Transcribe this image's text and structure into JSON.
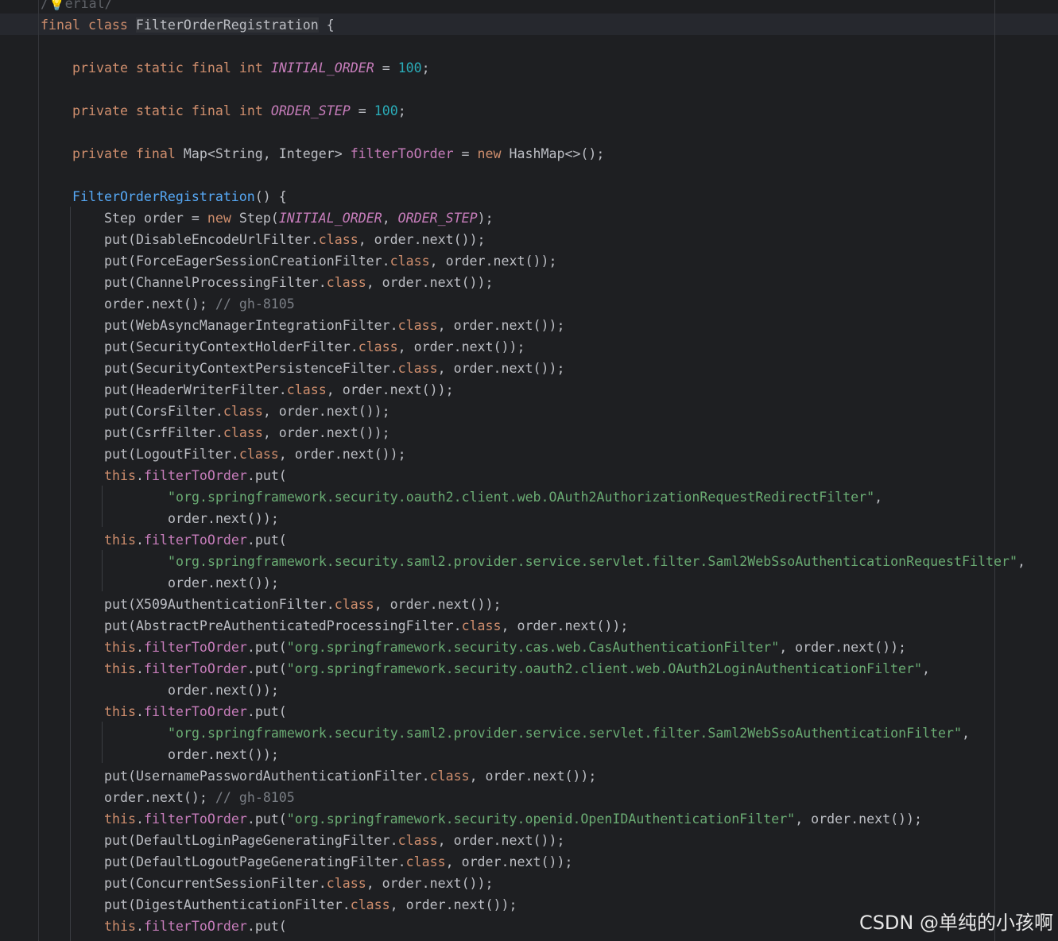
{
  "editor": {
    "lines": [
      {
        "indent": 0,
        "tokens": [
          {
            "t": "/",
            "c": "dim"
          },
          {
            "t": "💡",
            "c": "bulb"
          },
          {
            "t": "erial/",
            "c": "dim"
          }
        ]
      },
      {
        "indent": 0,
        "tokens": [
          {
            "t": "final",
            "c": "kw"
          },
          {
            "t": " "
          },
          {
            "t": "class",
            "c": "kw"
          },
          {
            "t": " "
          },
          {
            "t": "FilterOrderRegistration",
            "c": "cls"
          },
          {
            "t": " {"
          }
        ]
      },
      {
        "indent": 0,
        "tokens": []
      },
      {
        "indent": 1,
        "tokens": [
          {
            "t": "private",
            "c": "kw"
          },
          {
            "t": " "
          },
          {
            "t": "static",
            "c": "kw"
          },
          {
            "t": " "
          },
          {
            "t": "final",
            "c": "kw"
          },
          {
            "t": " "
          },
          {
            "t": "int",
            "c": "kw"
          },
          {
            "t": " "
          },
          {
            "t": "INITIAL_ORDER",
            "c": "const"
          },
          {
            "t": " = "
          },
          {
            "t": "100",
            "c": "num"
          },
          {
            "t": ";"
          }
        ]
      },
      {
        "indent": 0,
        "tokens": []
      },
      {
        "indent": 1,
        "tokens": [
          {
            "t": "private",
            "c": "kw"
          },
          {
            "t": " "
          },
          {
            "t": "static",
            "c": "kw"
          },
          {
            "t": " "
          },
          {
            "t": "final",
            "c": "kw"
          },
          {
            "t": " "
          },
          {
            "t": "int",
            "c": "kw"
          },
          {
            "t": " "
          },
          {
            "t": "ORDER_STEP",
            "c": "const"
          },
          {
            "t": " = "
          },
          {
            "t": "100",
            "c": "num"
          },
          {
            "t": ";"
          }
        ]
      },
      {
        "indent": 0,
        "tokens": []
      },
      {
        "indent": 1,
        "tokens": [
          {
            "t": "private",
            "c": "kw"
          },
          {
            "t": " "
          },
          {
            "t": "final",
            "c": "kw"
          },
          {
            "t": " Map<String, Integer> "
          },
          {
            "t": "filterToOrder",
            "c": "field"
          },
          {
            "t": " = "
          },
          {
            "t": "new",
            "c": "kw"
          },
          {
            "t": " HashMap<>();"
          }
        ]
      },
      {
        "indent": 0,
        "tokens": []
      },
      {
        "indent": 1,
        "tokens": [
          {
            "t": "FilterOrderRegistration",
            "c": "fn"
          },
          {
            "t": "() {"
          }
        ]
      },
      {
        "indent": 2,
        "tokens": [
          {
            "t": "Step order = "
          },
          {
            "t": "new",
            "c": "kw"
          },
          {
            "t": " Step("
          },
          {
            "t": "INITIAL_ORDER",
            "c": "const"
          },
          {
            "t": ", "
          },
          {
            "t": "ORDER_STEP",
            "c": "const"
          },
          {
            "t": ");"
          }
        ]
      },
      {
        "indent": 2,
        "tokens": [
          {
            "t": "put(DisableEncodeUrlFilter."
          },
          {
            "t": "class",
            "c": "kw"
          },
          {
            "t": ", order.next());"
          }
        ]
      },
      {
        "indent": 2,
        "tokens": [
          {
            "t": "put(ForceEagerSessionCreationFilter."
          },
          {
            "t": "class",
            "c": "kw"
          },
          {
            "t": ", order.next());"
          }
        ]
      },
      {
        "indent": 2,
        "tokens": [
          {
            "t": "put(ChannelProcessingFilter."
          },
          {
            "t": "class",
            "c": "kw"
          },
          {
            "t": ", order.next());"
          }
        ]
      },
      {
        "indent": 2,
        "tokens": [
          {
            "t": "order.next(); "
          },
          {
            "t": "// gh-8105",
            "c": "cmt"
          }
        ]
      },
      {
        "indent": 2,
        "tokens": [
          {
            "t": "put(WebAsyncManagerIntegrationFilter."
          },
          {
            "t": "class",
            "c": "kw"
          },
          {
            "t": ", order.next());"
          }
        ]
      },
      {
        "indent": 2,
        "tokens": [
          {
            "t": "put(SecurityContextHolderFilter."
          },
          {
            "t": "class",
            "c": "kw"
          },
          {
            "t": ", order.next());"
          }
        ]
      },
      {
        "indent": 2,
        "tokens": [
          {
            "t": "put(SecurityContextPersistenceFilter."
          },
          {
            "t": "class",
            "c": "kw"
          },
          {
            "t": ", order.next());"
          }
        ]
      },
      {
        "indent": 2,
        "tokens": [
          {
            "t": "put(HeaderWriterFilter."
          },
          {
            "t": "class",
            "c": "kw"
          },
          {
            "t": ", order.next());"
          }
        ]
      },
      {
        "indent": 2,
        "tokens": [
          {
            "t": "put(CorsFilter."
          },
          {
            "t": "class",
            "c": "kw"
          },
          {
            "t": ", order.next());"
          }
        ]
      },
      {
        "indent": 2,
        "tokens": [
          {
            "t": "put(CsrfFilter."
          },
          {
            "t": "class",
            "c": "kw"
          },
          {
            "t": ", order.next());"
          }
        ]
      },
      {
        "indent": 2,
        "tokens": [
          {
            "t": "put(LogoutFilter."
          },
          {
            "t": "class",
            "c": "kw"
          },
          {
            "t": ", order.next());"
          }
        ]
      },
      {
        "indent": 2,
        "tokens": [
          {
            "t": "this",
            "c": "kw"
          },
          {
            "t": "."
          },
          {
            "t": "filterToOrder",
            "c": "field"
          },
          {
            "t": ".put("
          }
        ]
      },
      {
        "indent": 4,
        "tokens": [
          {
            "t": "\"org.springframework.security.oauth2.client.web.OAuth2AuthorizationRequestRedirectFilter\"",
            "c": "str"
          },
          {
            "t": ","
          }
        ]
      },
      {
        "indent": 4,
        "tokens": [
          {
            "t": "order.next());"
          }
        ]
      },
      {
        "indent": 2,
        "tokens": [
          {
            "t": "this",
            "c": "kw"
          },
          {
            "t": "."
          },
          {
            "t": "filterToOrder",
            "c": "field"
          },
          {
            "t": ".put("
          }
        ]
      },
      {
        "indent": 4,
        "tokens": [
          {
            "t": "\"org.springframework.security.saml2.provider.service.servlet.filter.Saml2WebSsoAuthenticationRequestFilter\"",
            "c": "str"
          },
          {
            "t": ","
          }
        ]
      },
      {
        "indent": 4,
        "tokens": [
          {
            "t": "order.next());"
          }
        ]
      },
      {
        "indent": 2,
        "tokens": [
          {
            "t": "put(X509AuthenticationFilter."
          },
          {
            "t": "class",
            "c": "kw"
          },
          {
            "t": ", order.next());"
          }
        ]
      },
      {
        "indent": 2,
        "tokens": [
          {
            "t": "put(AbstractPreAuthenticatedProcessingFilter."
          },
          {
            "t": "class",
            "c": "kw"
          },
          {
            "t": ", order.next());"
          }
        ]
      },
      {
        "indent": 2,
        "tokens": [
          {
            "t": "this",
            "c": "kw"
          },
          {
            "t": "."
          },
          {
            "t": "filterToOrder",
            "c": "field"
          },
          {
            "t": ".put("
          },
          {
            "t": "\"org.springframework.security.cas.web.CasAuthenticationFilter\"",
            "c": "str"
          },
          {
            "t": ", order.next());"
          }
        ]
      },
      {
        "indent": 2,
        "tokens": [
          {
            "t": "this",
            "c": "kw"
          },
          {
            "t": "."
          },
          {
            "t": "filterToOrder",
            "c": "field"
          },
          {
            "t": ".put("
          },
          {
            "t": "\"org.springframework.security.oauth2.client.web.OAuth2LoginAuthenticationFilter\"",
            "c": "str"
          },
          {
            "t": ","
          }
        ]
      },
      {
        "indent": 4,
        "tokens": [
          {
            "t": "order.next());"
          }
        ]
      },
      {
        "indent": 2,
        "tokens": [
          {
            "t": "this",
            "c": "kw"
          },
          {
            "t": "."
          },
          {
            "t": "filterToOrder",
            "c": "field"
          },
          {
            "t": ".put("
          }
        ]
      },
      {
        "indent": 4,
        "tokens": [
          {
            "t": "\"org.springframework.security.saml2.provider.service.servlet.filter.Saml2WebSsoAuthenticationFilter\"",
            "c": "str"
          },
          {
            "t": ","
          }
        ]
      },
      {
        "indent": 4,
        "tokens": [
          {
            "t": "order.next());"
          }
        ]
      },
      {
        "indent": 2,
        "tokens": [
          {
            "t": "put(UsernamePasswordAuthenticationFilter."
          },
          {
            "t": "class",
            "c": "kw"
          },
          {
            "t": ", order.next());"
          }
        ]
      },
      {
        "indent": 2,
        "tokens": [
          {
            "t": "order.next(); "
          },
          {
            "t": "// gh-8105",
            "c": "cmt"
          }
        ]
      },
      {
        "indent": 2,
        "tokens": [
          {
            "t": "this",
            "c": "kw"
          },
          {
            "t": "."
          },
          {
            "t": "filterToOrder",
            "c": "field"
          },
          {
            "t": ".put("
          },
          {
            "t": "\"org.springframework.security.openid.OpenIDAuthenticationFilter\"",
            "c": "str"
          },
          {
            "t": ", order.next());"
          }
        ]
      },
      {
        "indent": 2,
        "tokens": [
          {
            "t": "put(DefaultLoginPageGeneratingFilter."
          },
          {
            "t": "class",
            "c": "kw"
          },
          {
            "t": ", order.next());"
          }
        ]
      },
      {
        "indent": 2,
        "tokens": [
          {
            "t": "put(DefaultLogoutPageGeneratingFilter."
          },
          {
            "t": "class",
            "c": "kw"
          },
          {
            "t": ", order.next());"
          }
        ]
      },
      {
        "indent": 2,
        "tokens": [
          {
            "t": "put(ConcurrentSessionFilter."
          },
          {
            "t": "class",
            "c": "kw"
          },
          {
            "t": ", order.next());"
          }
        ]
      },
      {
        "indent": 2,
        "tokens": [
          {
            "t": "put(DigestAuthenticationFilter."
          },
          {
            "t": "class",
            "c": "kw"
          },
          {
            "t": ", order.next());"
          }
        ]
      },
      {
        "indent": 2,
        "tokens": [
          {
            "t": "this",
            "c": "kw"
          },
          {
            "t": "."
          },
          {
            "t": "filterToOrder",
            "c": "field"
          },
          {
            "t": ".put("
          }
        ]
      }
    ]
  },
  "watermark": "CSDN @单纯的小孩啊"
}
